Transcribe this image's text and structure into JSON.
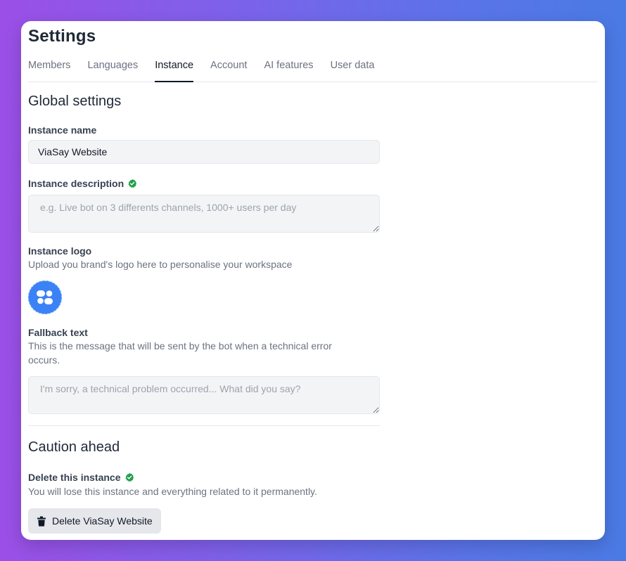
{
  "header": {
    "title": "Settings"
  },
  "tabs": [
    {
      "label": "Members"
    },
    {
      "label": "Languages"
    },
    {
      "label": "Instance",
      "active": true
    },
    {
      "label": "Account"
    },
    {
      "label": "AI features"
    },
    {
      "label": "User data"
    }
  ],
  "global": {
    "heading": "Global settings",
    "instance_name": {
      "label": "Instance name",
      "value": "ViaSay Website"
    },
    "instance_description": {
      "label": "Instance description",
      "placeholder": "e.g. Live bot on 3 differents channels, 1000+ users per day",
      "icon": "verified-check-icon"
    },
    "instance_logo": {
      "label": "Instance logo",
      "help": "Upload you brand's logo here to personalise your workspace",
      "icon": "brand-logo-icon"
    },
    "fallback": {
      "label": "Fallback text",
      "help": "This is the message that will be sent by the bot when a technical error occurs.",
      "placeholder": "I'm sorry, a technical problem occurred... What did you say?"
    }
  },
  "caution": {
    "heading": "Caution ahead",
    "delete": {
      "label": "Delete this instance",
      "help": "You will lose this instance and everything related to it permanently.",
      "button_label": "Delete ViaSay Website",
      "icon": "trash-icon"
    }
  },
  "colors": {
    "accent": "#3b82f6",
    "verified": "#22a04b",
    "text_primary": "#1f2937",
    "text_muted": "#6b7280",
    "input_bg": "#f3f4f6"
  }
}
